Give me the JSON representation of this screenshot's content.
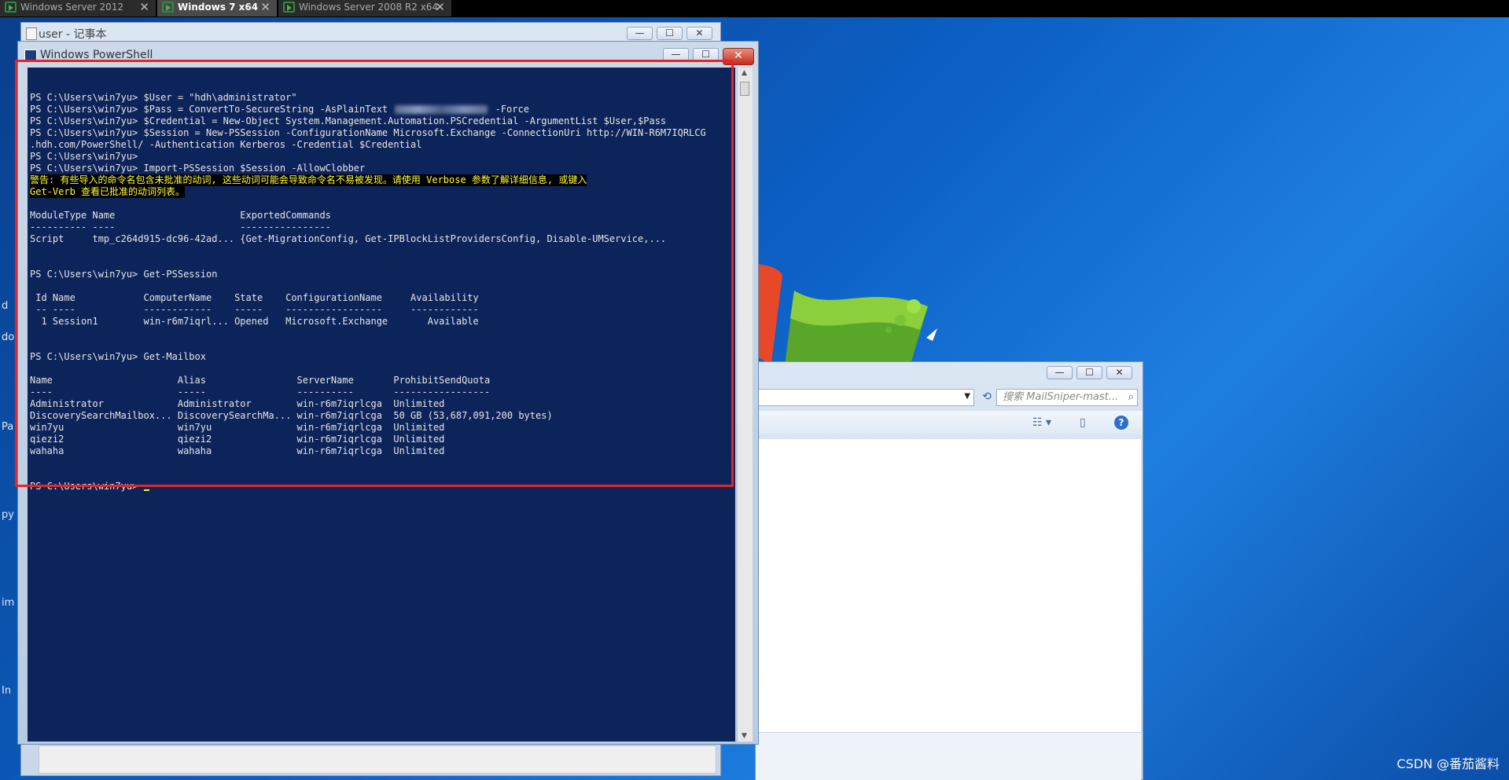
{
  "tabs": [
    {
      "label": "Windows Server 2012",
      "close": "✕"
    },
    {
      "label": "Windows 7 x64",
      "close": "✕"
    },
    {
      "label": "Windows Server 2008 R2 x64",
      "close": "✕"
    }
  ],
  "notepad": {
    "title": "user - 记事本"
  },
  "powershell": {
    "title": "Windows PowerShell"
  },
  "captions": {
    "min": "—",
    "max": "☐",
    "close": "✕"
  },
  "console": {
    "l1": "PS C:\\Users\\win7yu> $User = \"hdh\\administrator\"",
    "l2a": "PS C:\\Users\\win7yu> $Pass = ConvertTo-SecureString -AsPlainText ",
    "l2b": " -Force",
    "l3": "PS C:\\Users\\win7yu> $Credential = New-Object System.Management.Automation.PSCredential -ArgumentList $User,$Pass",
    "l4": "PS C:\\Users\\win7yu> $Session = New-PSSession -ConfigurationName Microsoft.Exchange -ConnectionUri http://WIN-R6M7IQRLCG",
    "l5": ".hdh.com/PowerShell/ -Authentication Kerberos -Credential $Credential",
    "l6": "PS C:\\Users\\win7yu>",
    "l7": "PS C:\\Users\\win7yu> Import-PSSession $Session -AllowClobber",
    "warn1": "警告: 有些导入的命令名包含未批准的动词, 这些动词可能会导致命令名不易被发现。请使用 Verbose 参数了解详细信息, 或键入",
    "warn2": "Get-Verb 查看已批准的动词列表。",
    "mod_head": "ModuleType Name                      ExportedCommands",
    "mod_sep": "---------- ----                      ----------------",
    "mod_row": "Script     tmp_c264d915-dc96-42ad... {Get-MigrationConfig, Get-IPBlockListProvidersConfig, Disable-UMService,...",
    "cmd_session": "PS C:\\Users\\win7yu> Get-PSSession",
    "sess_head": " Id Name            ComputerName    State    ConfigurationName     Availability",
    "sess_sep": " -- ----            ------------    -----    -----------------     ------------",
    "sess_row": "  1 Session1        win-r6m7iqrl... Opened   Microsoft.Exchange       Available",
    "cmd_mailbox": "PS C:\\Users\\win7yu> Get-Mailbox",
    "mb_head": "Name                      Alias                ServerName       ProhibitSendQuota",
    "mb_sep": "----                      -----                ----------       -----------------",
    "mb_rows": [
      "Administrator             Administrator        win-r6m7iqrlcga  Unlimited",
      "DiscoverySearchMailbox... DiscoverySearchMa... win-r6m7iqrlcga  50 GB (53,687,091,200 bytes)",
      "win7yu                    win7yu               win-r6m7iqrlcga  Unlimited",
      "qiezi2                    qiezi2               win-r6m7iqrlcga  Unlimited",
      "wahaha                    wahaha               win-r6m7iqrlcga  Unlimited"
    ],
    "prompt": "PS C:\\Users\\win7yu> "
  },
  "explorer": {
    "search_placeholder": "搜索 MailSniper-mast..."
  },
  "desktop": {
    "edge_labels": [
      "d",
      "do",
      "Pa",
      "py",
      "im",
      "In"
    ]
  },
  "watermark": "CSDN @番茄酱料",
  "colors": {
    "console_bg": "#0c2459",
    "warning_text": "#ffff2e",
    "highlight_box": "#e32626"
  }
}
